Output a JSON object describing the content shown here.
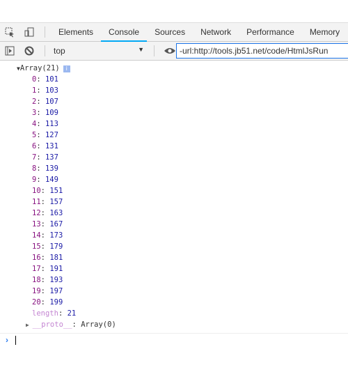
{
  "tabs": [
    "Elements",
    "Console",
    "Sources",
    "Network",
    "Performance",
    "Memory"
  ],
  "active_tab": "Console",
  "toolbar": {
    "context": "top",
    "filter_value": "-url:http://tools.jb51.net/code/HtmlJsRun"
  },
  "console": {
    "array_label": "Array(21)",
    "items": [
      {
        "k": "0",
        "v": "101"
      },
      {
        "k": "1",
        "v": "103"
      },
      {
        "k": "2",
        "v": "107"
      },
      {
        "k": "3",
        "v": "109"
      },
      {
        "k": "4",
        "v": "113"
      },
      {
        "k": "5",
        "v": "127"
      },
      {
        "k": "6",
        "v": "131"
      },
      {
        "k": "7",
        "v": "137"
      },
      {
        "k": "8",
        "v": "139"
      },
      {
        "k": "9",
        "v": "149"
      },
      {
        "k": "10",
        "v": "151"
      },
      {
        "k": "11",
        "v": "157"
      },
      {
        "k": "12",
        "v": "163"
      },
      {
        "k": "13",
        "v": "167"
      },
      {
        "k": "14",
        "v": "173"
      },
      {
        "k": "15",
        "v": "179"
      },
      {
        "k": "16",
        "v": "181"
      },
      {
        "k": "17",
        "v": "191"
      },
      {
        "k": "18",
        "v": "193"
      },
      {
        "k": "19",
        "v": "197"
      },
      {
        "k": "20",
        "v": "199"
      }
    ],
    "length_key": "length",
    "length_value": "21",
    "proto_key": "__proto__",
    "proto_value": "Array(0)"
  }
}
